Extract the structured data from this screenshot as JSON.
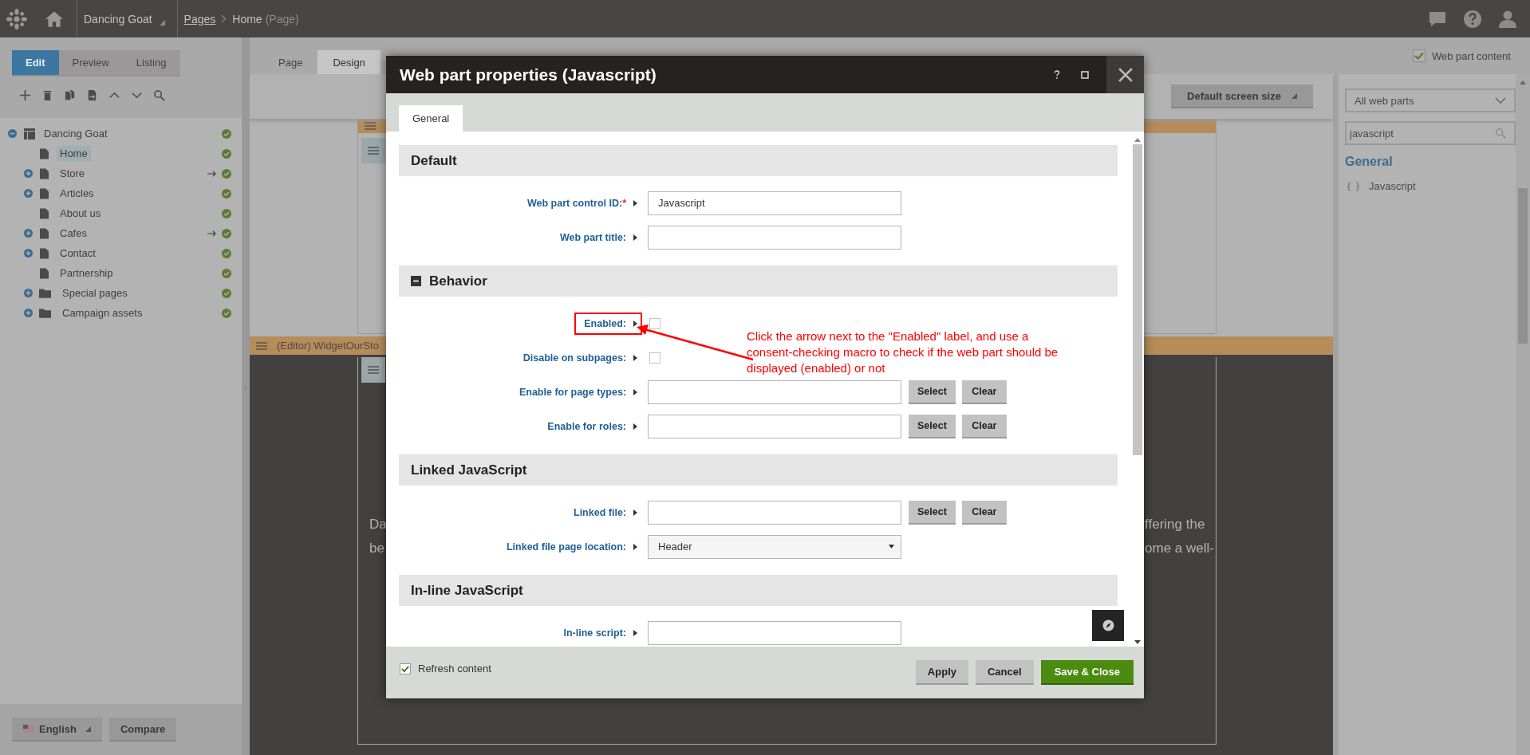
{
  "top_bar": {
    "site": "Dancing Goat",
    "breadcrumb": [
      {
        "label": "Pages",
        "link": true
      },
      {
        "label": "Home",
        "link": false
      }
    ],
    "page_type": "(Page)"
  },
  "left_panel": {
    "mode_tabs": [
      {
        "label": "Edit",
        "selected": true
      },
      {
        "label": "Preview",
        "selected": false
      },
      {
        "label": "Listing",
        "selected": false
      }
    ],
    "tree": {
      "label": "Dancing Goat",
      "expandable": true,
      "expanded": true,
      "published": true,
      "children": [
        {
          "label": "Home",
          "kind": "page",
          "expandable": false,
          "selected": true,
          "redirect": false,
          "published": true
        },
        {
          "label": "Store",
          "kind": "page",
          "expandable": true,
          "expanded": false,
          "selected": false,
          "redirect": true,
          "published": true
        },
        {
          "label": "Articles",
          "kind": "page",
          "expandable": true,
          "expanded": false,
          "selected": false,
          "redirect": false,
          "published": true
        },
        {
          "label": "About us",
          "kind": "page",
          "expandable": false,
          "selected": false,
          "redirect": false,
          "published": true
        },
        {
          "label": "Cafes",
          "kind": "page",
          "expandable": true,
          "expanded": false,
          "selected": false,
          "redirect": true,
          "published": true
        },
        {
          "label": "Contact",
          "kind": "page",
          "expandable": true,
          "expanded": false,
          "selected": false,
          "redirect": false,
          "published": true
        },
        {
          "label": "Partnership",
          "kind": "page",
          "expandable": false,
          "selected": false,
          "redirect": false,
          "published": true
        },
        {
          "label": "Special pages",
          "kind": "folder",
          "expandable": true,
          "expanded": false,
          "selected": false,
          "redirect": false,
          "published": true
        },
        {
          "label": "Campaign assets",
          "kind": "folder",
          "expandable": true,
          "expanded": false,
          "selected": false,
          "redirect": false,
          "published": true
        }
      ]
    },
    "language": "English",
    "compare": "Compare"
  },
  "design_tabs": [
    {
      "label": "Page",
      "selected": false
    },
    {
      "label": "Design",
      "selected": true
    }
  ],
  "toolbar": {
    "screen_size": "Default screen size"
  },
  "canvas": {
    "zone_title": "(Editor) WidgetOurSto",
    "text_left": [
      "Da",
      "be"
    ],
    "text_right": [
      "ffering the",
      "ome a well-"
    ]
  },
  "right_panel": {
    "web_part_content": {
      "label": "Web part content",
      "checked": true
    },
    "category": "All web parts",
    "search": "javascript",
    "group": "General",
    "items": [
      {
        "label": "Javascript"
      }
    ]
  },
  "dialog": {
    "title": "Web part properties (Javascript)",
    "tabs": [
      {
        "label": "General",
        "selected": true
      }
    ],
    "sections": [
      {
        "title": "Default",
        "collapsible": false,
        "fields": [
          {
            "label": "Web part control ID:",
            "required_mark": "*",
            "kind": "text",
            "value": "Javascript",
            "highlighted": false
          },
          {
            "label": "Web part title:",
            "kind": "text",
            "highlighted": false
          }
        ]
      },
      {
        "title": "Behavior",
        "collapsible": true,
        "fields": [
          {
            "label": "Enabled:",
            "kind": "checkbox",
            "checked": false,
            "highlighted": true
          },
          {
            "label": "Disable on subpages:",
            "kind": "checkbox",
            "checked": false,
            "highlighted": false
          },
          {
            "label": "Enable for page types:",
            "kind": "selector",
            "buttons": [
              "Select",
              "Clear"
            ],
            "highlighted": false
          },
          {
            "label": "Enable for roles:",
            "kind": "selector",
            "buttons": [
              "Select",
              "Clear"
            ],
            "highlighted": false
          }
        ]
      },
      {
        "title": "Linked JavaScript",
        "collapsible": false,
        "fields": [
          {
            "label": "Linked file:",
            "kind": "selector",
            "buttons": [
              "Select",
              "Clear"
            ],
            "highlighted": false
          },
          {
            "label": "Linked file page location:",
            "kind": "dropdown",
            "value": "Header",
            "highlighted": false
          }
        ]
      },
      {
        "title": "In-line JavaScript",
        "collapsible": false,
        "fields": [
          {
            "label": "In-line script:",
            "kind": "text",
            "highlighted": false
          }
        ]
      }
    ],
    "annotation": "Click the arrow next to the \"Enabled\" label, and use a consent-checking macro to check if the web part should be displayed (enabled) or not",
    "refresh": {
      "label": "Refresh content",
      "checked": true
    },
    "buttons": [
      {
        "label": "Apply",
        "kind": "secondary"
      },
      {
        "label": "Cancel",
        "kind": "secondary"
      },
      {
        "label": "Save & Close",
        "kind": "primary"
      }
    ]
  }
}
